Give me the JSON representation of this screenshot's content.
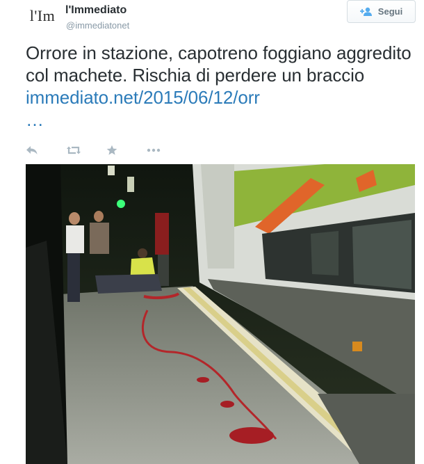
{
  "author": {
    "avatar_text": "l'Im",
    "name": "l'Immediato",
    "handle": "@immediatonet"
  },
  "follow_button": {
    "label": "Segui"
  },
  "tweet": {
    "text": "Orrore in stazione, capotreno foggiano aggredito col machete. Rischia di perdere un braccio",
    "link": "immediato.net/2015/06/12/orr",
    "ellipsis": "…"
  },
  "actions": {
    "icons": [
      "reply-icon",
      "retweet-icon",
      "favorite-icon",
      "more-icon"
    ]
  },
  "colors": {
    "link": "#2b7bb9",
    "icon": "#aab8c2",
    "text": "#292f33",
    "muted": "#8899a6"
  }
}
